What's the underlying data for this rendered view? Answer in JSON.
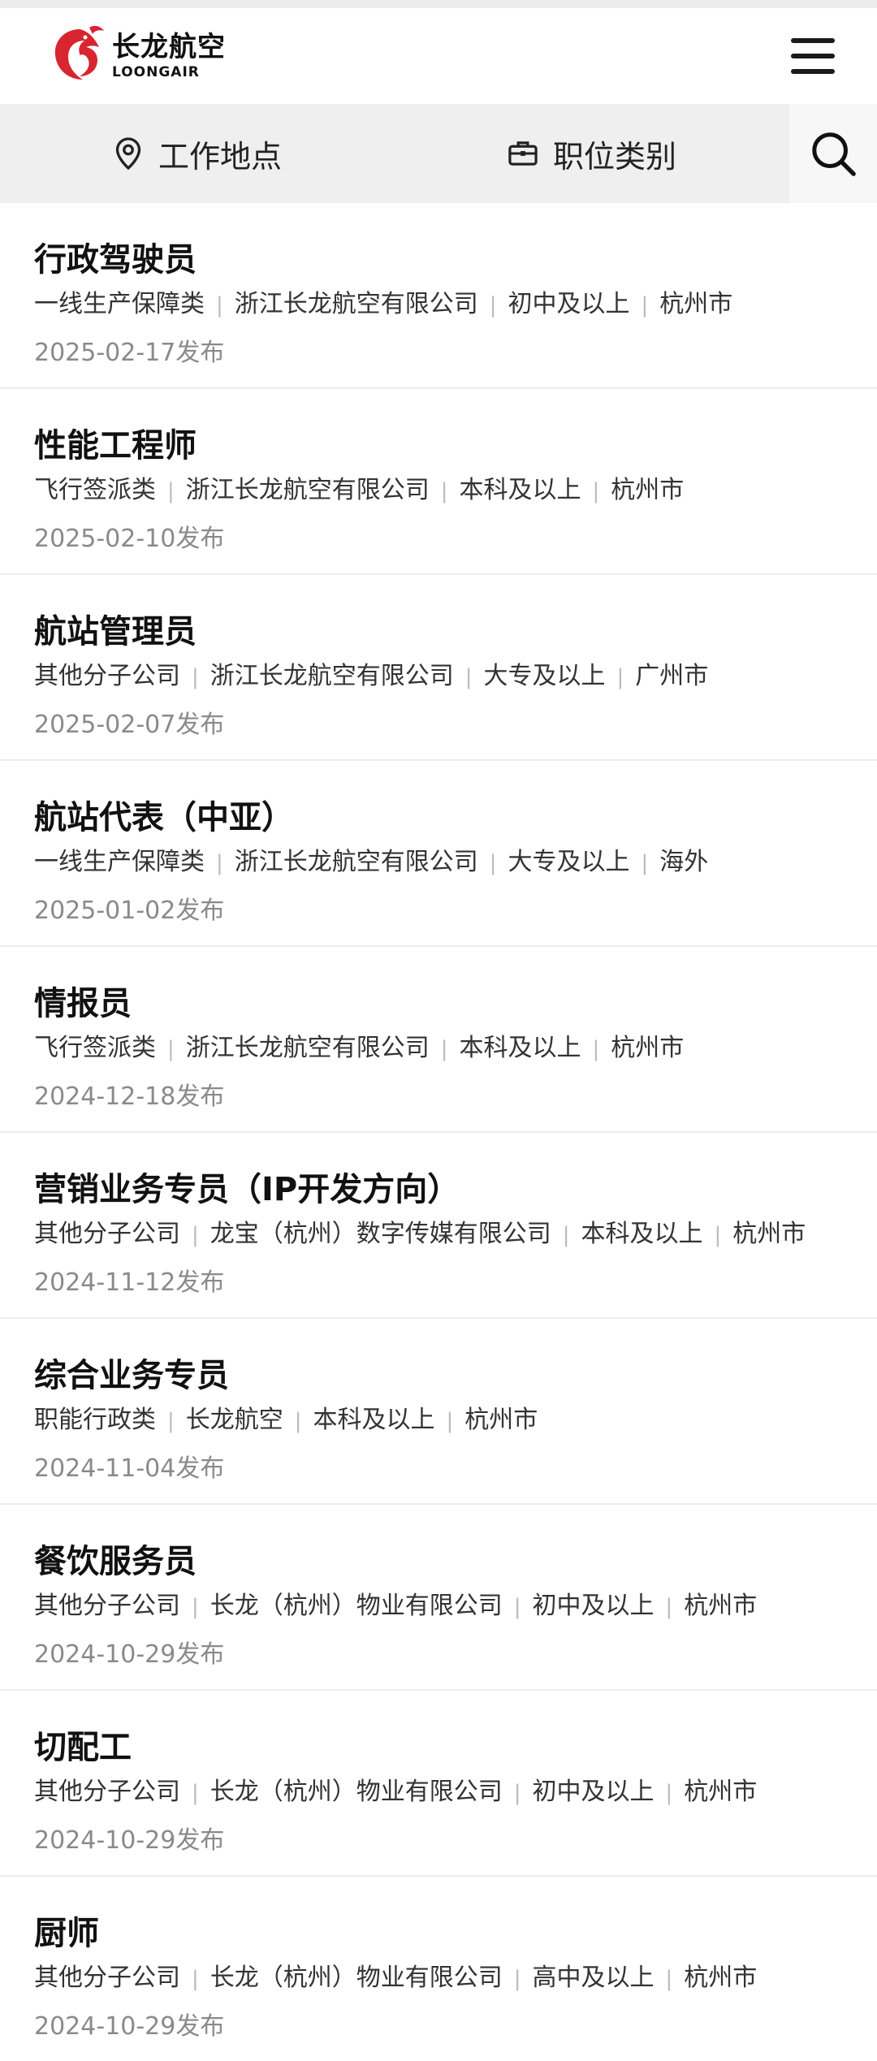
{
  "brand": {
    "name_cn": "长龙航空",
    "name_en": "LOONGAIR",
    "accent_color": "#d7262f"
  },
  "filters": {
    "location_label": "工作地点",
    "category_label": "职位类别",
    "location_icon": "map-pin-icon",
    "category_icon": "briefcase-icon",
    "search_icon": "search-icon",
    "menu_icon": "hamburger-menu-icon"
  },
  "jobs": [
    {
      "title": "行政驾驶员",
      "category": "一线生产保障类",
      "company": "浙江长龙航空有限公司",
      "education": "初中及以上",
      "city": "杭州市",
      "date": "2025-02-17发布"
    },
    {
      "title": "性能工程师",
      "category": "飞行签派类",
      "company": "浙江长龙航空有限公司",
      "education": "本科及以上",
      "city": "杭州市",
      "date": "2025-02-10发布"
    },
    {
      "title": "航站管理员",
      "category": "其他分子公司",
      "company": "浙江长龙航空有限公司",
      "education": "大专及以上",
      "city": "广州市",
      "date": "2025-02-07发布"
    },
    {
      "title": "航站代表（中亚）",
      "category": "一线生产保障类",
      "company": "浙江长龙航空有限公司",
      "education": "大专及以上",
      "city": "海外",
      "date": "2025-01-02发布"
    },
    {
      "title": "情报员",
      "category": "飞行签派类",
      "company": "浙江长龙航空有限公司",
      "education": "本科及以上",
      "city": "杭州市",
      "date": "2024-12-18发布"
    },
    {
      "title": "营销业务专员（IP开发方向）",
      "category": "其他分子公司",
      "company": "龙宝（杭州）数字传媒有限公司",
      "education": "本科及以上",
      "city": "杭州市",
      "date": "2024-11-12发布"
    },
    {
      "title": "综合业务专员",
      "category": "职能行政类",
      "company": "长龙航空",
      "education": "本科及以上",
      "city": "杭州市",
      "date": "2024-11-04发布"
    },
    {
      "title": "餐饮服务员",
      "category": "其他分子公司",
      "company": "长龙（杭州）物业有限公司",
      "education": "初中及以上",
      "city": "杭州市",
      "date": "2024-10-29发布"
    },
    {
      "title": "切配工",
      "category": "其他分子公司",
      "company": "长龙（杭州）物业有限公司",
      "education": "初中及以上",
      "city": "杭州市",
      "date": "2024-10-29发布"
    },
    {
      "title": "厨师",
      "category": "其他分子公司",
      "company": "长龙（杭州）物业有限公司",
      "education": "高中及以上",
      "city": "杭州市",
      "date": "2024-10-29发布"
    }
  ]
}
